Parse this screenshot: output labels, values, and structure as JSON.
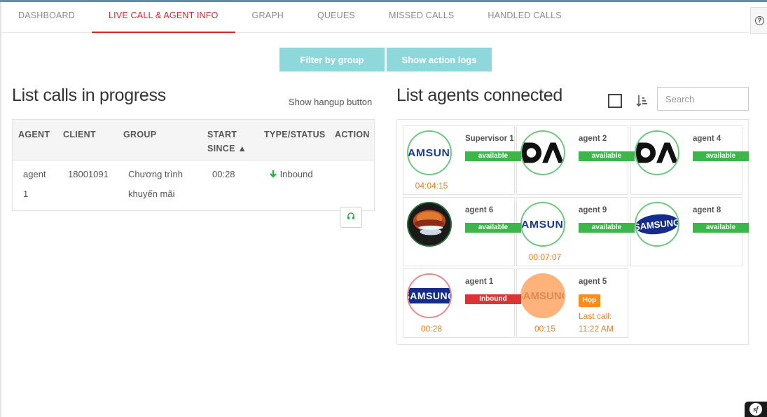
{
  "tabs": [
    "DASHBOARD",
    "LIVE CALL & AGENT INFO",
    "GRAPH",
    "QUEUES",
    "MISSED CALLS",
    "HANDLED CALLS"
  ],
  "active_tab": "LIVE CALL & AGENT INFO",
  "buttons": {
    "filter_by_group": "Filter by group",
    "show_action_logs": "Show action logs"
  },
  "calls": {
    "title": "List calls in progress",
    "hangup_toggle": "Show hangup button",
    "columns": {
      "agent": "AGENT",
      "client": "CLIENT",
      "group": "GROUP",
      "start_line1": "START",
      "start_line2": "SINCE ▲",
      "type_status": "TYPE/STATUS",
      "action": "ACTION"
    },
    "rows": [
      {
        "agent_line1": "agent",
        "agent_line2": "1",
        "client": "18001091",
        "group_line1": "Chương trình",
        "group_line2": "khuyến mãi",
        "start_since": "00:28",
        "type_status": "Inbound",
        "status_icon": "arrow-down-icon",
        "action_icon": "headset-icon"
      }
    ]
  },
  "agents": {
    "title": "List agents connected",
    "search_placeholder": "Search",
    "cards": [
      {
        "name": "Supervisor 1",
        "status": "available",
        "timer": "04:04:15",
        "avatar_text": "SAMSUNG"
      },
      {
        "name": "agent 2",
        "status": "available",
        "timer": "",
        "avatar_text": ""
      },
      {
        "name": "agent 4",
        "status": "available",
        "timer": "",
        "avatar_text": ""
      },
      {
        "name": "agent 6",
        "status": "available",
        "timer": "",
        "avatar_text": ""
      },
      {
        "name": "agent 9",
        "status": "available",
        "timer": "00:07:07",
        "avatar_text": "SAMSUNG"
      },
      {
        "name": "agent 8",
        "status": "available",
        "timer": "",
        "avatar_text": "SAMSUNG"
      },
      {
        "name": "agent 1",
        "status": "Inbound",
        "timer": "00:28",
        "avatar_text": "SAMSUNG"
      },
      {
        "name": "agent 5",
        "status": "Họp",
        "timer": "00:15",
        "avatar_text": "SAMSUNG",
        "last_call_label": "Last call:",
        "last_call_time": "11:22 AM"
      }
    ]
  },
  "colors": {
    "accent_red": "#d9262b",
    "button_teal": "#8ed8dc",
    "available_green": "#3cb54a",
    "inbound_red": "#dd3333",
    "busy_orange": "#ff8c1a",
    "timer_orange": "#e67e22"
  },
  "icons": {
    "help": "question-circle-icon",
    "sort": "sort-amount-icon",
    "checkbox": "checkbox-icon",
    "symfony": "symfony-icon"
  },
  "help_glyph": "?",
  "symfony_glyph": "sf"
}
